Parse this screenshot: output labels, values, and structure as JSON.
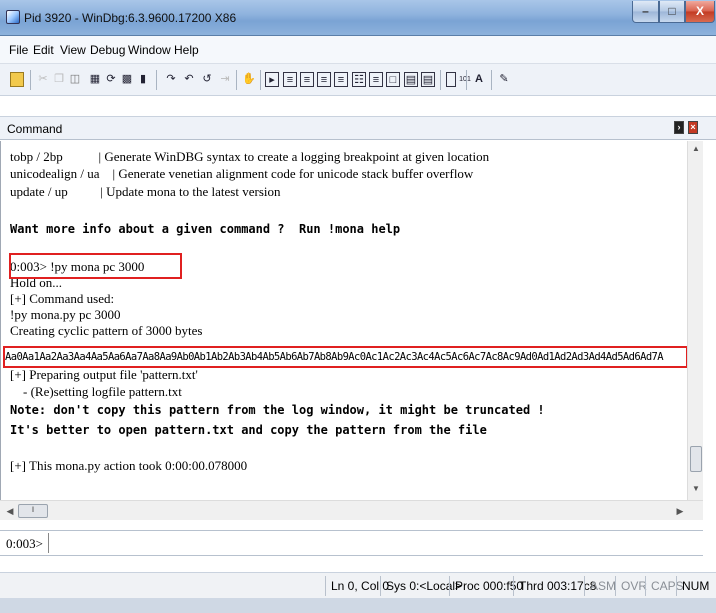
{
  "window": {
    "title": "Pid 3920 - WinDbg:6.3.9600.17200 X86",
    "minimize_glyph": "–",
    "maximize_glyph": "□",
    "close_glyph": "X"
  },
  "menu": [
    "File",
    "Edit",
    "View",
    "Debug",
    "Window",
    "Help"
  ],
  "toolbar": {
    "icons": [
      "open-icon",
      "cut-icon",
      "copy-icon",
      "paste-icon",
      "go-icon",
      "restart-icon",
      "stop-icon",
      "break-icon",
      "step-into-icon",
      "step-over-icon",
      "step-out-icon",
      "run-to-cursor-icon",
      "breakpoint-icon",
      "command-window-icon",
      "watch-icon",
      "locals-icon",
      "registers-icon",
      "memory-icon",
      "call-stack-icon",
      "disassembly-icon",
      "scratch-pad-icon",
      "source-mode-icon",
      "font-icon",
      "options-icon"
    ],
    "font_label": "A",
    "binary_label": "101"
  },
  "command_window": {
    "title": "Command",
    "lines": [
      "tobp / 2bp           | Generate WinDBG syntax to create a logging breakpoint at given location",
      "unicodealign / ua    | Generate venetian alignment code for unicode stack buffer overflow",
      "update / up          | Update mona to the latest version",
      "",
      "Want more info about a given command ?  Run !mona help",
      "",
      "0:003> !py mona pc 3000",
      "Hold on...",
      "[+] Command used:",
      "!py mona.py pc 3000",
      "Creating cyclic pattern of 3000 bytes",
      "Aa0Aa1Aa2Aa3Aa4Aa5Aa6Aa7Aa8Aa9Ab0Ab1Ab2Ab3Ab4Ab5Ab6Ab7Ab8Ab9Ac0Ac1Ac2Ac3Ac4Ac5Ac6Ac7Ac8Ac9Ad0Ad1Ad2Ad3Ad4Ad5Ad6Ad7A",
      "[+] Preparing output file 'pattern.txt'",
      "    - (Re)setting logfile pattern.txt",
      "Note: don't copy this pattern from the log window, it might be truncated !",
      "It's better to open pattern.txt and copy the pattern from the file",
      "",
      "[+] This mona.py action took 0:00:00.078000"
    ],
    "prompt": "0:003>",
    "input_value": "",
    "highlight_color": "#e02020"
  },
  "status": {
    "position": "Ln 0, Col 0",
    "sys": "Sys 0:<Local>",
    "proc": "Proc 000:f50",
    "thrd": "Thrd 003:17c8",
    "asm": "ASM",
    "ovr": "OVR",
    "caps": "CAPS",
    "num": "NUM"
  }
}
